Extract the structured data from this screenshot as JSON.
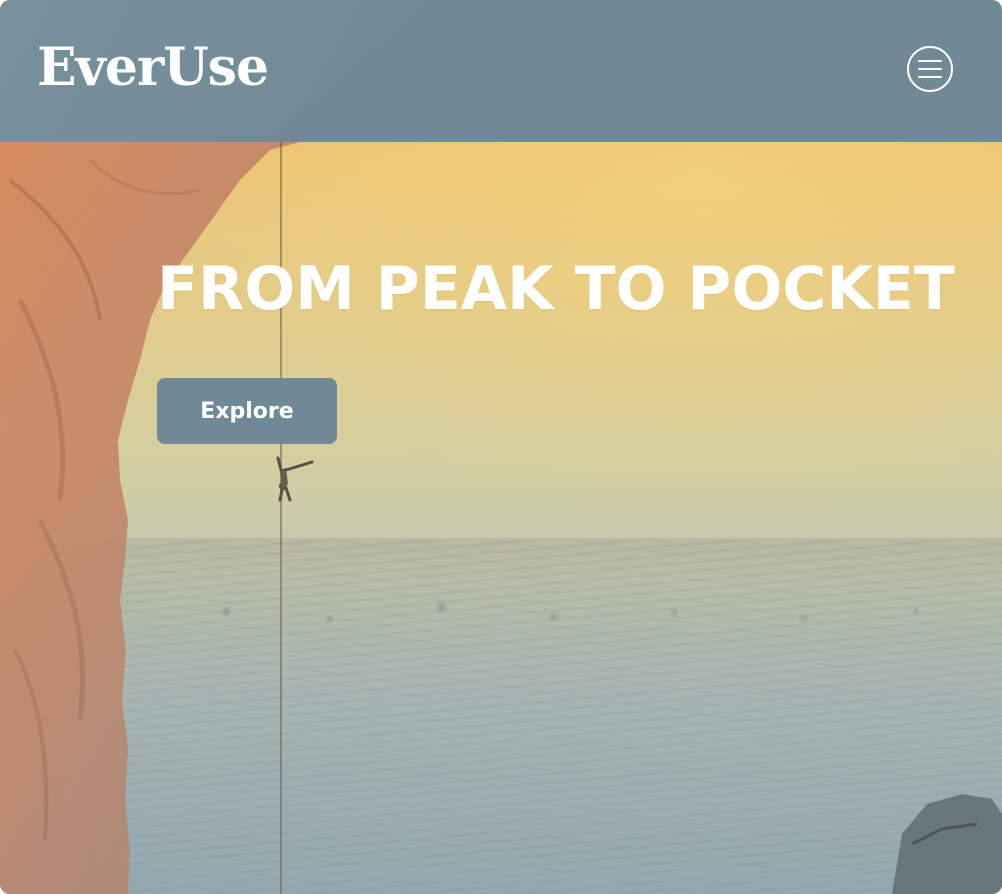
{
  "header": {
    "logo_text": "EverUse",
    "menu_icon": "hamburger-menu-icon",
    "background_color": "#6f8a96"
  },
  "hero": {
    "title": "FROM PEAK TO POCKET",
    "cta_label": "Explore",
    "cta_color": "#6f8a96"
  }
}
